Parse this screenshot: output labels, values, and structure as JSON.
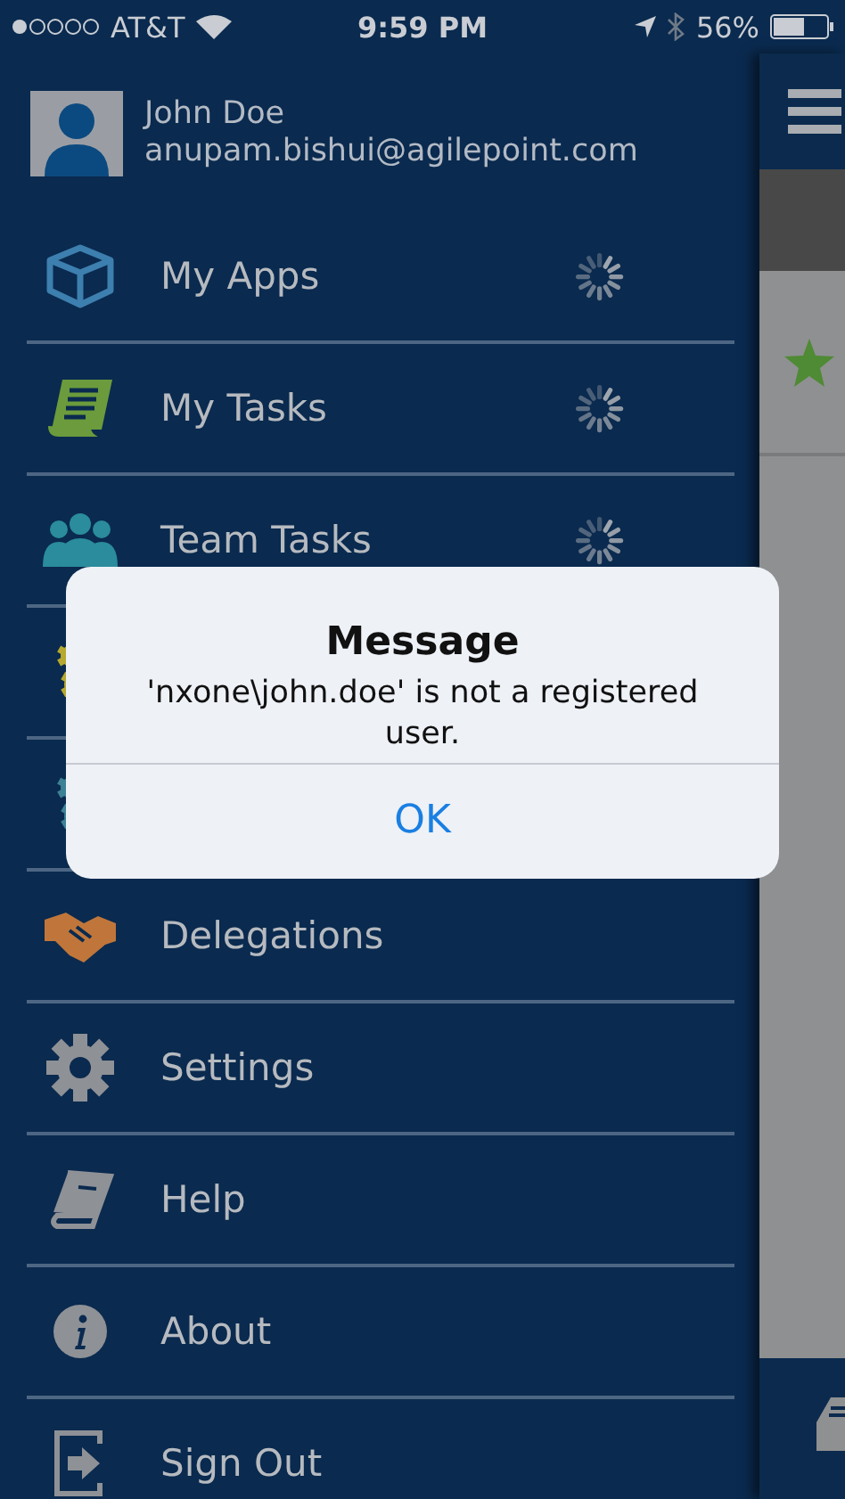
{
  "status_bar": {
    "carrier": "AT&T",
    "time": "9:59 PM",
    "battery": "56%"
  },
  "profile": {
    "name": "John Doe",
    "email": "anupam.bishui@agilepoint.com"
  },
  "menu": [
    {
      "label": "My Apps",
      "loading": true
    },
    {
      "label": "My Tasks",
      "loading": true
    },
    {
      "label": "Team Tasks",
      "loading": true
    },
    {
      "loading": false
    },
    {
      "loading": false
    },
    {
      "label": "Delegations",
      "loading": false
    },
    {
      "label": "Settings",
      "loading": false
    },
    {
      "label": "Help",
      "loading": false
    },
    {
      "label": "About",
      "loading": false
    },
    {
      "label": "Sign Out",
      "loading": false
    }
  ],
  "dialog": {
    "title": "Message",
    "message": "'nxone\\john.doe' is not a registered user.",
    "button": "OK"
  }
}
